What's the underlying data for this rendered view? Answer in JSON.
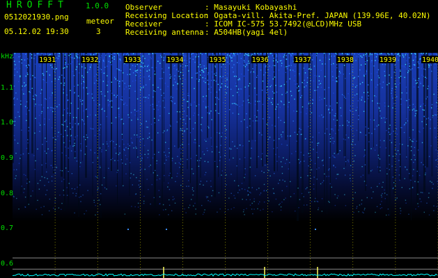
{
  "app": {
    "title": "HROFFT",
    "version": "1.0.0"
  },
  "file": {
    "name": "0512021930.png",
    "datetime": "05.12.02 19:30"
  },
  "meteor": {
    "label": "meteor",
    "count": "3"
  },
  "info": [
    {
      "key": "Observer",
      "value": ": Masayuki Kobayashi"
    },
    {
      "key": "Receiving Location",
      "value": ": Ogata-vill. Akita-Pref. JAPAN (139.96E, 40.02N)"
    },
    {
      "key": "Receiver",
      "value": ": ICOM IC-575 53.7492(@LCD)MHz USB"
    },
    {
      "key": "Receiving antenna",
      "value": ": A504HB(yagi 4el)"
    }
  ],
  "colors": {
    "label_text": "#ffff00",
    "axis_text": "#00e000",
    "signal": "#00ffff",
    "background": "#000000"
  },
  "chart_data": {
    "type": "heatmap",
    "ylabel": "kHz",
    "y_ticks": [
      "1.1",
      "1.0",
      "0.9",
      "0.8",
      "0.7",
      "0.6"
    ],
    "x_ticks": [
      "1931",
      "1932",
      "1933",
      "1934",
      "1935",
      "1936",
      "1937",
      "1938",
      "1939",
      "1940"
    ],
    "ylim": [
      0.56,
      1.2
    ],
    "xlim": [
      1930,
      1940
    ]
  }
}
